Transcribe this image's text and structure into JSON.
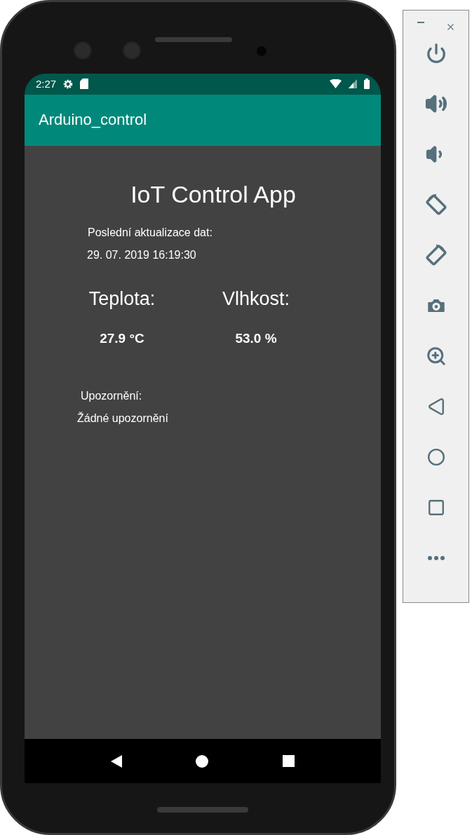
{
  "status_bar": {
    "time": "2:27"
  },
  "app_bar": {
    "title": "Arduino_control"
  },
  "content": {
    "heading": "IoT Control App",
    "update_label": "Poslední aktualizace dat:",
    "update_value": "29. 07. 2019 16:19:30",
    "readings": [
      {
        "label": "Teplota:",
        "value": "27.9 °C"
      },
      {
        "label": "Vlhkost:",
        "value": "53.0 %"
      }
    ],
    "alert_label": "Upozornění:",
    "alert_value": "Žádné upozornění"
  },
  "nav_bar": {
    "buttons": [
      {
        "kind": "back"
      },
      {
        "kind": "home"
      },
      {
        "kind": "recents"
      }
    ]
  },
  "emulator_toolbar": {
    "window_buttons": [
      {
        "kind": "minimize"
      },
      {
        "kind": "close"
      }
    ],
    "tools": [
      {
        "kind": "power"
      },
      {
        "kind": "volume_up"
      },
      {
        "kind": "volume_down"
      },
      {
        "kind": "rotate_left"
      },
      {
        "kind": "rotate_right"
      },
      {
        "kind": "camera"
      },
      {
        "kind": "zoom"
      },
      {
        "kind": "back"
      },
      {
        "kind": "home"
      },
      {
        "kind": "overview"
      },
      {
        "kind": "more"
      }
    ]
  }
}
